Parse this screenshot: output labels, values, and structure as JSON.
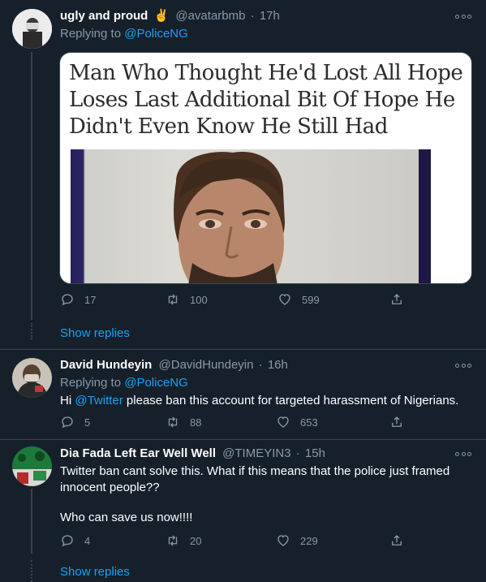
{
  "tweets": [
    {
      "name": "ugly and proud",
      "name_emoji": "✌",
      "handle": "@avatarbmb",
      "sep": "·",
      "time": "17h",
      "replying_label": "Replying to",
      "replying_to": "@PoliceNG",
      "media": {
        "headline": "Man Who Thought He'd Lost All Hope Loses Last Additional Bit Of Hope He Didn't Even Know He Still Had"
      },
      "reply_count": "17",
      "retweet_count": "100",
      "like_count": "599",
      "show_replies": "Show replies"
    },
    {
      "name": "David Hundeyin",
      "handle": "@DavidHundeyin",
      "sep": "·",
      "time": "16h",
      "replying_label": "Replying to",
      "replying_to": "@PoliceNG",
      "text_prefix": "Hi",
      "text_mention": "@Twitter",
      "text_rest": "please ban this account for targeted harassment of Nigerians.",
      "reply_count": "5",
      "retweet_count": "88",
      "like_count": "653"
    },
    {
      "name": "Dia Fada Left Ear Well Well",
      "handle": "@TIMEYIN3",
      "sep": "·",
      "time": "15h",
      "text_line1": "Twitter ban cant solve this. What if this means that the police just framed innocent people??",
      "text_line2": "Who can save us now!!!!",
      "reply_count": "4",
      "retweet_count": "20",
      "like_count": "229",
      "show_replies": "Show replies"
    }
  ],
  "colors": {
    "background": "#15202b",
    "accent": "#1da1f2",
    "secondary_text": "#8899a6",
    "divider": "#38444d"
  }
}
